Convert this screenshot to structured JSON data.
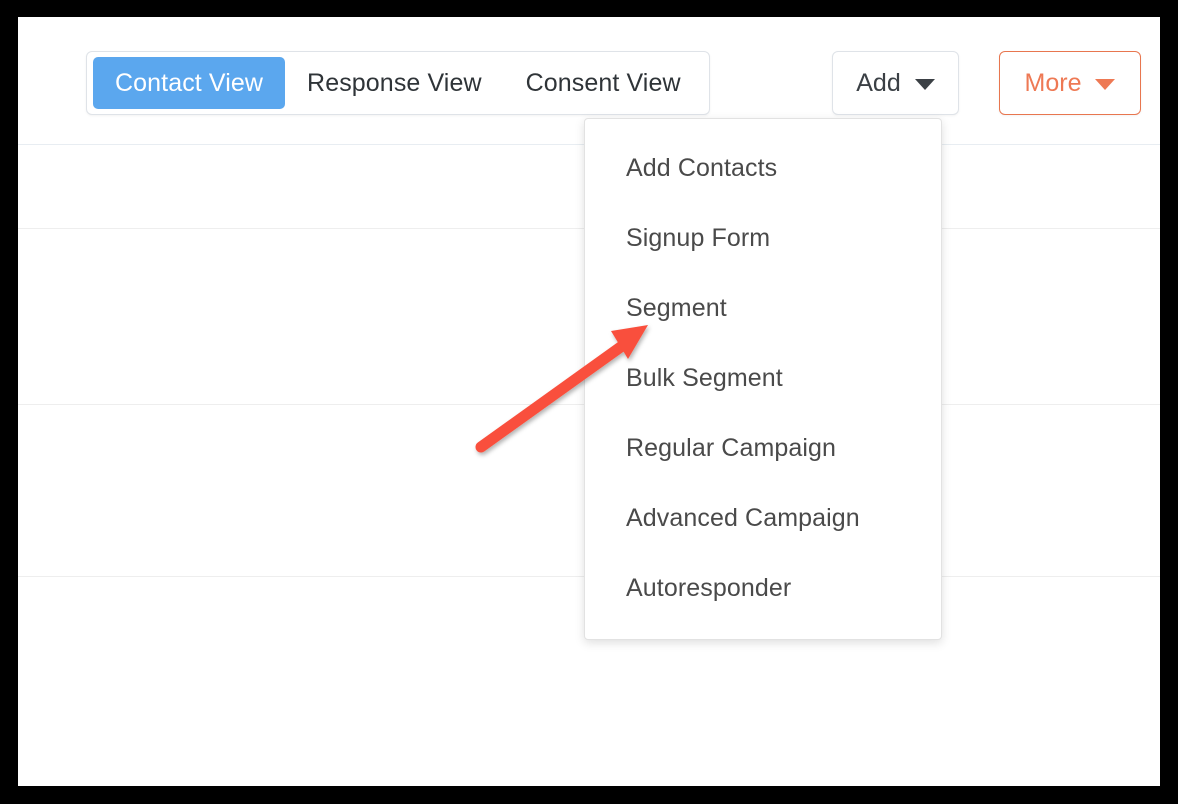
{
  "window": {
    "frame_color": "#000000",
    "surface_color": "#ffffff"
  },
  "toolbar": {
    "view_tabs": [
      {
        "label": "Contact View",
        "active": true
      },
      {
        "label": "Response View",
        "active": false
      },
      {
        "label": "Consent View",
        "active": false
      }
    ],
    "add_button": {
      "label": "Add",
      "caret_icon": "chevron-down-icon",
      "expanded": true
    },
    "more_button": {
      "label": "More",
      "caret_icon": "chevron-down-icon",
      "color": "#EE7954"
    }
  },
  "add_dropdown": {
    "items": [
      {
        "label": "Add Contacts"
      },
      {
        "label": "Signup Form"
      },
      {
        "label": "Segment"
      },
      {
        "label": "Bulk Segment"
      },
      {
        "label": "Regular Campaign"
      },
      {
        "label": "Advanced Campaign"
      },
      {
        "label": "Autoresponder"
      }
    ]
  },
  "annotation": {
    "arrow": {
      "color": "#F9503C",
      "points_to": "Segment"
    }
  },
  "colors": {
    "accent_blue": "#5BA7EE",
    "accent_orange": "#EE7954",
    "annotation_red": "#F9503C",
    "text_primary": "#3b4045",
    "text_menu": "#4a4a4a",
    "border": "#dfe3e8",
    "separator_tinted": "#e8edf2",
    "separator_plain": "#eeeeee"
  },
  "background_rows": {
    "separator_offsets": [
      127,
      211,
      387,
      559
    ]
  }
}
